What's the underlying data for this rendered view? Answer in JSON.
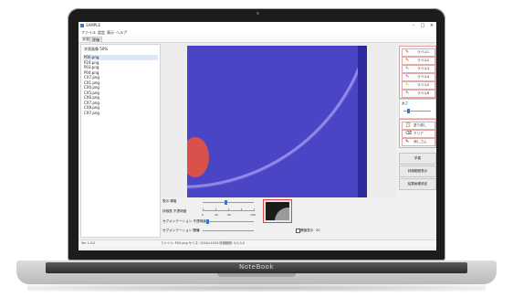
{
  "window": {
    "title": "SAMPLE",
    "controls": {
      "minimize": "–",
      "maximize": "□",
      "close": "×"
    }
  },
  "menu": [
    "ファイル",
    "設定",
    "表示",
    "ヘルプ"
  ],
  "tabs": [
    {
      "label": "学習"
    },
    {
      "label": "評価"
    }
  ],
  "file_list": {
    "header": "学習画像 50%",
    "items": [
      "P00.png",
      "P24.png",
      "P03.png",
      "P04.png",
      "CX7.png",
      "CX1.png",
      "CX0.png",
      "CX5.png",
      "CX6.png",
      "CX7.png",
      "CX8.png",
      "CX7.png"
    ],
    "selected_index": 0
  },
  "controls": {
    "label1": "表示 輝度",
    "label2": "評価表 不透明度",
    "label3": "セグメンテーション 不透明度",
    "label4": "セグメンテーション 閾値",
    "slider_ticks": [
      "0",
      "20",
      "50",
      "100"
    ],
    "threshold_value": "0",
    "extra_label": "閾値表示",
    "extra_value": "20"
  },
  "tools": {
    "items": [
      {
        "label": "ラベル1",
        "color": "#c0392b"
      },
      {
        "label": "ラベル2",
        "color": "#d35400"
      },
      {
        "label": "ラベル3",
        "color": "#27ae60"
      },
      {
        "label": "ラベル4",
        "color": "#8e44ad"
      },
      {
        "label": "ラベル5",
        "color": "#f1c40f"
      },
      {
        "label": "ラベル6",
        "color": "#2980b9"
      }
    ]
  },
  "size": {
    "label": "太さ"
  },
  "actions": [
    {
      "icon": "📋",
      "label": "塗り潰し"
    },
    {
      "icon": "⌫",
      "label": "クリア"
    },
    {
      "icon": "✎",
      "label": "消しゴム"
    }
  ],
  "buttons": {
    "train": "学習",
    "eval_region": "評価範囲表示",
    "eval_region_settings": "結果画像設定"
  },
  "statusbar": {
    "left": "Ver 1.0.0",
    "middle": "ファイル: P00.png  サイズ: 1024×1024  評価範囲: 0,0,0,0"
  },
  "laptop": {
    "brand": "NoteBook"
  },
  "colors": {
    "image_blue": "#4a45c4",
    "colony_red": "#d8524b",
    "accent": "#3a79c8",
    "highlight_border": "#e3a0a0"
  }
}
